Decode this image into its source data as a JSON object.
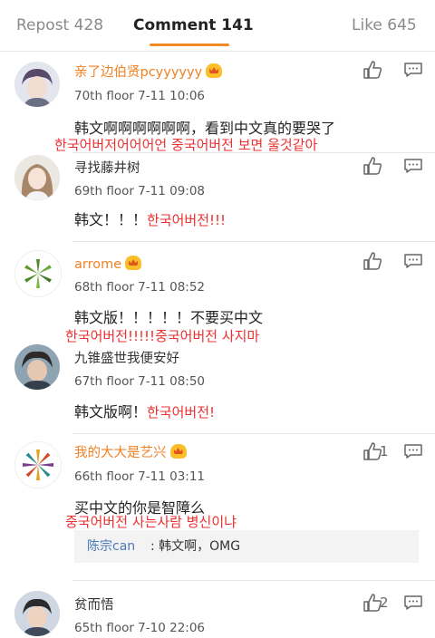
{
  "tabs": {
    "repost": "Repost 428",
    "comment": "Comment 141",
    "like": "Like 645"
  },
  "comments": [
    {
      "username": "亲了边伯贤pcyyyyyy",
      "meta": "70th floor 7-11 10:06",
      "text": "韩文啊啊啊啊啊啊，看到中文真的要哭了",
      "korean_overlay": "한국어버저어어어언 중국어버전 보면 울것같아",
      "avatar": "user-avatar"
    },
    {
      "username": "寻找藤井树",
      "meta": "69th floor 7-11 09:08",
      "text": "韩文！！！",
      "korean_inline": "한국어버전!!!",
      "avatar": "user-avatar"
    },
    {
      "username": "arrome",
      "meta": "68th floor 7-11 08:52",
      "text": "韩文版！！！！！不要买中文",
      "korean_overlay": "한국어버전!!!!!중국어버전 사지마",
      "avatar": "leaf-logo-avatar"
    },
    {
      "username": "九锥盛世我便安好",
      "meta": "67th floor 7-11 08:50",
      "text": "韩文版啊！",
      "korean_inline": "한국어버전!",
      "avatar": "user-avatar"
    },
    {
      "username": "我的大大是艺兴",
      "meta": "66th floor 7-11 03:11",
      "text": "买中文的你是智障么",
      "korean_overlay": "중국어버전 사는사람 병신이냐",
      "like_count": "1",
      "reply_author": "陈宗can",
      "reply_text": ": 韩文啊，OMG",
      "avatar": "leaf-logo-avatar"
    },
    {
      "username": "贫而悟",
      "meta": "65th floor 7-10 22:06",
      "like_count": "2",
      "avatar": "user-avatar"
    }
  ],
  "colors": {
    "accent": "#f08224",
    "annotation": "#ee3030",
    "reply_link": "#4a79b9"
  },
  "icons": [
    "thumbs-up-icon",
    "comment-more-icon",
    "vip-crown-icon"
  ]
}
